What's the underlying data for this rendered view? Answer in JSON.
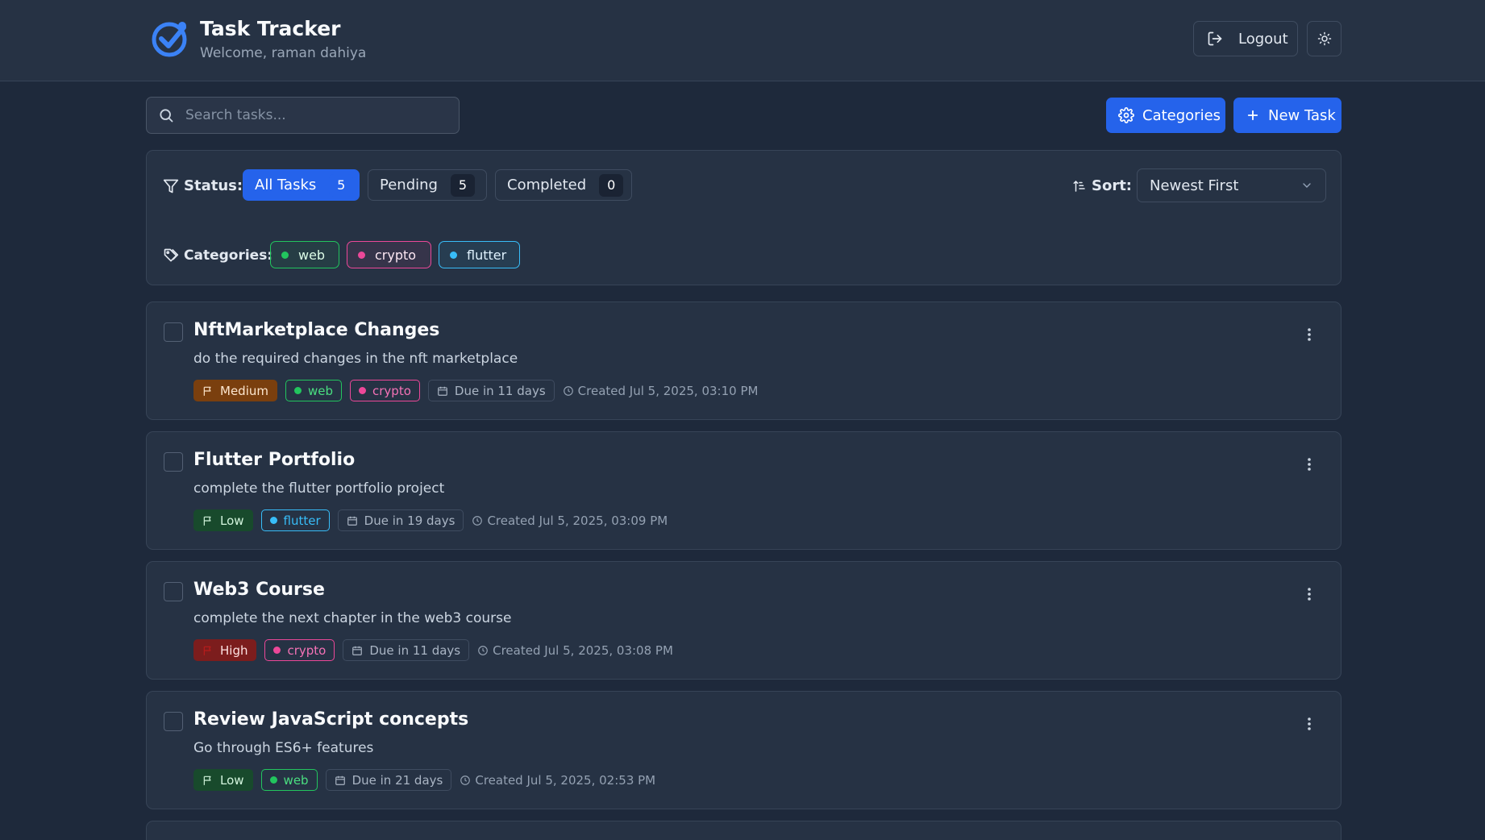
{
  "app": {
    "title": "Task Tracker",
    "welcome": "Welcome, raman dahiya"
  },
  "header": {
    "logout_label": "Logout"
  },
  "toolbar": {
    "search_placeholder": "Search tasks...",
    "categories_label": "Categories",
    "new_task_label": "New Task"
  },
  "filters": {
    "status_label": "Status:",
    "statuses": [
      {
        "label": "All Tasks",
        "count": "5",
        "active": true
      },
      {
        "label": "Pending",
        "count": "5"
      },
      {
        "label": "Completed",
        "count": "0"
      }
    ],
    "sort_label": "Sort:",
    "sort_value": "Newest First",
    "categories_label": "Categories:",
    "categories": [
      {
        "name": "web",
        "color": "#22c55e"
      },
      {
        "name": "crypto",
        "color": "#ec4899"
      },
      {
        "name": "flutter",
        "color": "#38bdf8"
      }
    ]
  },
  "tasks": [
    {
      "title": "NftMarketplace Changes",
      "description": "do the required changes in the nft marketplace",
      "priority": "Medium",
      "tags": [
        "web",
        "crypto"
      ],
      "due": "Due in 11 days",
      "created": "Created Jul 5, 2025, 03:10 PM"
    },
    {
      "title": "Flutter Portfolio",
      "description": "complete the flutter portfolio project",
      "priority": "Low",
      "tags": [
        "flutter"
      ],
      "due": "Due in 19 days",
      "created": "Created Jul 5, 2025, 03:09 PM"
    },
    {
      "title": "Web3 Course",
      "description": "complete the next chapter in the web3 course",
      "priority": "High",
      "tags": [
        "crypto"
      ],
      "due": "Due in 11 days",
      "created": "Created Jul 5, 2025, 03:08 PM"
    },
    {
      "title": "Review JavaScript concepts",
      "description": "Go through ES6+ features",
      "priority": "Low",
      "tags": [
        "web"
      ],
      "due": "Due in 21 days",
      "created": "Created Jul 5, 2025, 02:53 PM"
    }
  ],
  "colors": {
    "accent": "#2563eb",
    "tag_web": "#22c55e",
    "tag_crypto": "#ec4899",
    "tag_flutter": "#38bdf8"
  }
}
